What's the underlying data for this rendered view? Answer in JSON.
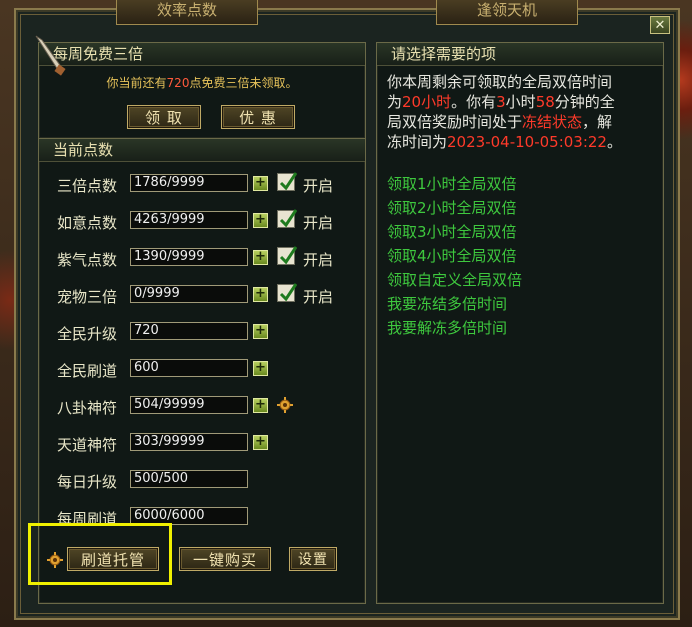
{
  "window": {
    "tab_left": "效率点数",
    "tab_right": "逢领天机",
    "close_symbol": "✕"
  },
  "weekly": {
    "title": "每周免费三倍",
    "notice_pre": "你当前还有",
    "notice_num": "720",
    "notice_post": "点免费三倍未领取。",
    "claim_label": "领 取",
    "discount_label": "优 惠"
  },
  "points": {
    "title": "当前点数",
    "on_label": "开启",
    "rows": [
      {
        "label": "三倍点数",
        "value": "1786/9999"
      },
      {
        "label": "如意点数",
        "value": "4263/9999"
      },
      {
        "label": "紫气点数",
        "value": "1390/9999"
      },
      {
        "label": "宠物三倍",
        "value": "0/9999"
      },
      {
        "label": "全民升级",
        "value": "720"
      },
      {
        "label": "全民刷道",
        "value": "600"
      },
      {
        "label": "八卦神符",
        "value": "504/99999"
      },
      {
        "label": "天道神符",
        "value": "303/99999"
      },
      {
        "label": "每日升级",
        "value": "500/500"
      },
      {
        "label": "每周刷道",
        "value": "6000/6000"
      }
    ]
  },
  "bottom": {
    "brush_label": "刷道托管",
    "buy_label": "一键购买",
    "settings_label": "设置"
  },
  "right": {
    "title": "请选择需要的项",
    "line1": "你本周剩余可领取的全局双倍时间",
    "line2_pre": "为",
    "hours": "20小时",
    "line2_mid": "。你有",
    "h3": "3",
    "line2_mid2": "小时",
    "m58": "58",
    "line2_post": "分钟的全",
    "line3_pre": "局双倍奖励时间处于",
    "frozen": "冻结状态",
    "line3_post": "，解",
    "line4_pre": "冻时间为",
    "unfreeze_time": "2023-04-10-05:03:22",
    "line4_post": "。",
    "options": [
      "领取1小时全局双倍",
      "领取2小时全局双倍",
      "领取3小时全局双倍",
      "领取4小时全局双倍",
      "领取自定义全局双倍",
      "我要冻结多倍时间",
      "我要解冻多倍时间"
    ]
  },
  "colors": {
    "accent_green": "#3ec83e",
    "highlight_red": "#ff3a2a",
    "frame_gold": "#c0aa66",
    "annotation_yellow": "#f0f000"
  }
}
